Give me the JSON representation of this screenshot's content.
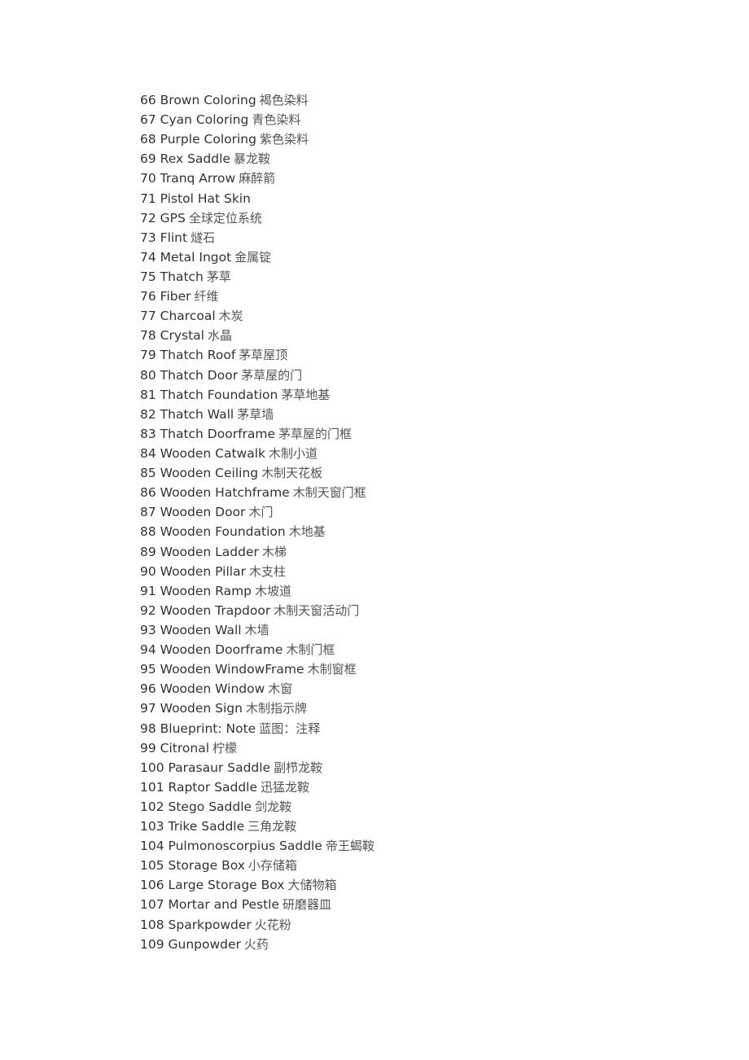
{
  "items": [
    {
      "num": "66",
      "en": "Brown Coloring",
      "zh": "褐色染料"
    },
    {
      "num": "67",
      "en": "Cyan Coloring",
      "zh": "青色染料"
    },
    {
      "num": "68",
      "en": "Purple Coloring",
      "zh": "紫色染料"
    },
    {
      "num": "69",
      "en": "Rex Saddle",
      "zh": "暴龙鞍"
    },
    {
      "num": "70",
      "en": "Tranq Arrow",
      "zh": "麻醉箭"
    },
    {
      "num": "71",
      "en": "Pistol Hat Skin",
      "zh": ""
    },
    {
      "num": "72",
      "en": "GPS",
      "zh": "全球定位系统"
    },
    {
      "num": "73",
      "en": "Flint",
      "zh": "燧石"
    },
    {
      "num": "74",
      "en": "Metal Ingot",
      "zh": "金属锭"
    },
    {
      "num": "75",
      "en": "Thatch",
      "zh": "茅草"
    },
    {
      "num": "76",
      "en": "Fiber",
      "zh": "纤维"
    },
    {
      "num": "77",
      "en": "Charcoal",
      "zh": "木炭"
    },
    {
      "num": "78",
      "en": "Crystal",
      "zh": "水晶"
    },
    {
      "num": "79",
      "en": "Thatch Roof",
      "zh": "茅草屋顶"
    },
    {
      "num": "80",
      "en": "Thatch Door",
      "zh": "茅草屋的门"
    },
    {
      "num": "81",
      "en": "Thatch Foundation",
      "zh": "茅草地基"
    },
    {
      "num": "82",
      "en": "Thatch Wall",
      "zh": "茅草墙"
    },
    {
      "num": "83",
      "en": "Thatch Doorframe",
      "zh": "茅草屋的门框"
    },
    {
      "num": "84",
      "en": "Wooden Catwalk",
      "zh": "木制小道"
    },
    {
      "num": "85",
      "en": "Wooden Ceiling",
      "zh": "木制天花板"
    },
    {
      "num": "86",
      "en": "Wooden Hatchframe",
      "zh": "木制天窗门框"
    },
    {
      "num": "87",
      "en": "Wooden Door",
      "zh": "木门"
    },
    {
      "num": "88",
      "en": "Wooden Foundation",
      "zh": "木地基"
    },
    {
      "num": "89",
      "en": "Wooden Ladder",
      "zh": "木梯"
    },
    {
      "num": "90",
      "en": "Wooden Pillar",
      "zh": "木支柱"
    },
    {
      "num": "91",
      "en": "Wooden Ramp",
      "zh": "木坡道"
    },
    {
      "num": "92",
      "en": "Wooden Trapdoor",
      "zh": "木制天窗活动门"
    },
    {
      "num": "93",
      "en": "Wooden Wall",
      "zh": "木墙"
    },
    {
      "num": "94",
      "en": "Wooden Doorframe",
      "zh": "木制门框"
    },
    {
      "num": "95",
      "en": "Wooden WindowFrame",
      "zh": "木制窗框"
    },
    {
      "num": "96",
      "en": "Wooden Window",
      "zh": "木窗"
    },
    {
      "num": "97",
      "en": "Wooden Sign",
      "zh": "木制指示牌"
    },
    {
      "num": "98",
      "en": "Blueprint: Note",
      "zh": "蓝图：注释"
    },
    {
      "num": "99",
      "en": "Citronal",
      "zh": "柠檬"
    },
    {
      "num": "100",
      "en": "Parasaur Saddle",
      "zh": "副栉龙鞍"
    },
    {
      "num": "101",
      "en": "Raptor Saddle",
      "zh": "迅猛龙鞍"
    },
    {
      "num": "102",
      "en": "Stego Saddle",
      "zh": "剑龙鞍"
    },
    {
      "num": "103",
      "en": "Trike Saddle",
      "zh": "三角龙鞍"
    },
    {
      "num": "104",
      "en": "Pulmonoscorpius Saddle",
      "zh": "帝王蝎鞍"
    },
    {
      "num": "105",
      "en": "Storage Box",
      "zh": "小存储箱"
    },
    {
      "num": "106",
      "en": "Large Storage Box",
      "zh": "大储物箱"
    },
    {
      "num": "107",
      "en": "Mortar and Pestle",
      "zh": "研磨器皿"
    },
    {
      "num": "108",
      "en": "Sparkpowder",
      "zh": "火花粉"
    },
    {
      "num": "109",
      "en": "Gunpowder",
      "zh": "火药"
    }
  ]
}
